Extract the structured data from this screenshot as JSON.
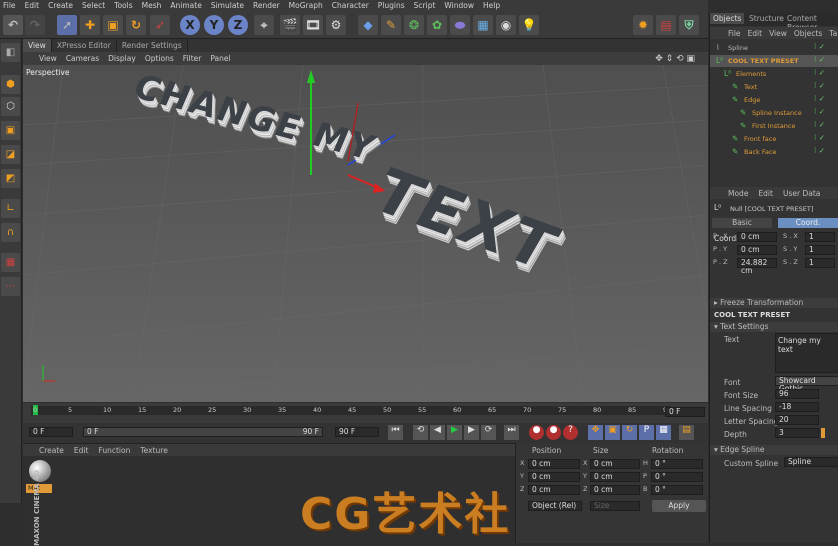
{
  "menubar": {
    "items": [
      "File",
      "Edit",
      "Create",
      "Select",
      "Tools",
      "Mesh",
      "Animate",
      "Simulate",
      "Render",
      "MoGraph",
      "Character",
      "Plugins",
      "Script",
      "Window",
      "Help"
    ]
  },
  "toolbar": {
    "axis_x": "X",
    "axis_y": "Y",
    "axis_z": "Z"
  },
  "viewport": {
    "tabs": [
      "View",
      "XPresso Editor",
      "Render Settings"
    ],
    "menu": [
      "View",
      "Cameras",
      "Display",
      "Options",
      "Filter",
      "Panel"
    ],
    "label": "Perspective",
    "scene_text_line1": "CHANGE MY",
    "scene_text_line2": "TEXT"
  },
  "timeline": {
    "ticks": [
      "0",
      "5",
      "10",
      "15",
      "20",
      "25",
      "30",
      "35",
      "40",
      "45",
      "50",
      "55",
      "60",
      "65",
      "70",
      "75",
      "80",
      "85",
      "90"
    ],
    "current_frame": "0 F"
  },
  "controls": {
    "start": "0 F",
    "range_start": "0 F",
    "range_end": "90 F",
    "end": "90 F"
  },
  "material_manager": {
    "menu": [
      "Create",
      "Edit",
      "Function",
      "Texture"
    ],
    "material_name": "Mat",
    "brand_vertical": "MAXON CINEMA 4D"
  },
  "coord_manager": {
    "headers": [
      "Position",
      "Size",
      "Rotation"
    ],
    "rows": [
      {
        "axis": "X",
        "pos": "0 cm",
        "size_axis": "X",
        "size": "0 cm",
        "rot_axis": "H",
        "rot": "0 °"
      },
      {
        "axis": "Y",
        "pos": "0 cm",
        "size_axis": "Y",
        "size": "0 cm",
        "rot_axis": "P",
        "rot": "0 °"
      },
      {
        "axis": "Z",
        "pos": "0 cm",
        "size_axis": "Z",
        "size": "0 cm",
        "rot_axis": "B",
        "rot": "0 °"
      }
    ],
    "mode": "Object (Rel)",
    "size_mode": "Size",
    "apply": "Apply"
  },
  "objects_panel": {
    "tabs": [
      "Objects",
      "Structure",
      "Content Browser"
    ],
    "menu": [
      "File",
      "Edit",
      "View",
      "Objects",
      "Ta"
    ],
    "items": [
      {
        "indent": 0,
        "name": "Spline",
        "color": "#bbbbbb"
      },
      {
        "indent": 0,
        "name": "COOL TEXT PRESET",
        "color": "#e09b38"
      },
      {
        "indent": 1,
        "name": "Elements",
        "color": "#e09b38"
      },
      {
        "indent": 2,
        "name": "Text",
        "color": "#e09b38"
      },
      {
        "indent": 2,
        "name": "Edge",
        "color": "#e09b38"
      },
      {
        "indent": 3,
        "name": "Spline Instance",
        "color": "#e09b38"
      },
      {
        "indent": 3,
        "name": "First Instance",
        "color": "#e09b38"
      },
      {
        "indent": 2,
        "name": "Front face",
        "color": "#e09b38"
      },
      {
        "indent": 2,
        "name": "Back Face",
        "color": "#e09b38"
      }
    ]
  },
  "attributes": {
    "menu": [
      "Mode",
      "Edit",
      "User Data"
    ],
    "object_title": "Null [COOL TEXT PRESET]",
    "tabs": [
      "Basic",
      "Coord."
    ],
    "section": "Coordinates",
    "coords": [
      {
        "p": "P . X",
        "pv": "0 cm",
        "s": "S . X",
        "sv": "1"
      },
      {
        "p": "P . Y",
        "pv": "0 cm",
        "s": "S . Y",
        "sv": "1"
      },
      {
        "p": "P . Z",
        "pv": "24.882 cm",
        "s": "S . Z",
        "sv": "1"
      }
    ],
    "freeze": "Freeze Transformation",
    "preset_title": "COOL TEXT PRESET",
    "text_settings": "Text Settings",
    "text_label": "Text",
    "text_value": "Change my text",
    "font_label": "Font",
    "font_value": "Showcard Gothic",
    "font_size_label": "Font Size",
    "font_size": "96",
    "line_spacing_label": "Line Spacing",
    "line_spacing": "-18",
    "letter_spacing_label": "Letter Spacing",
    "letter_spacing": "20",
    "depth_label": "Depth",
    "depth": "3",
    "edge_spline": "Edge Spline",
    "custom_spline_label": "Custom Spline",
    "custom_spline": "Spline"
  },
  "watermark": "CG艺术社",
  "colors": {
    "accent": "#e09b38",
    "selection": "#6a8fc0",
    "bg": "#2e2e2e"
  }
}
